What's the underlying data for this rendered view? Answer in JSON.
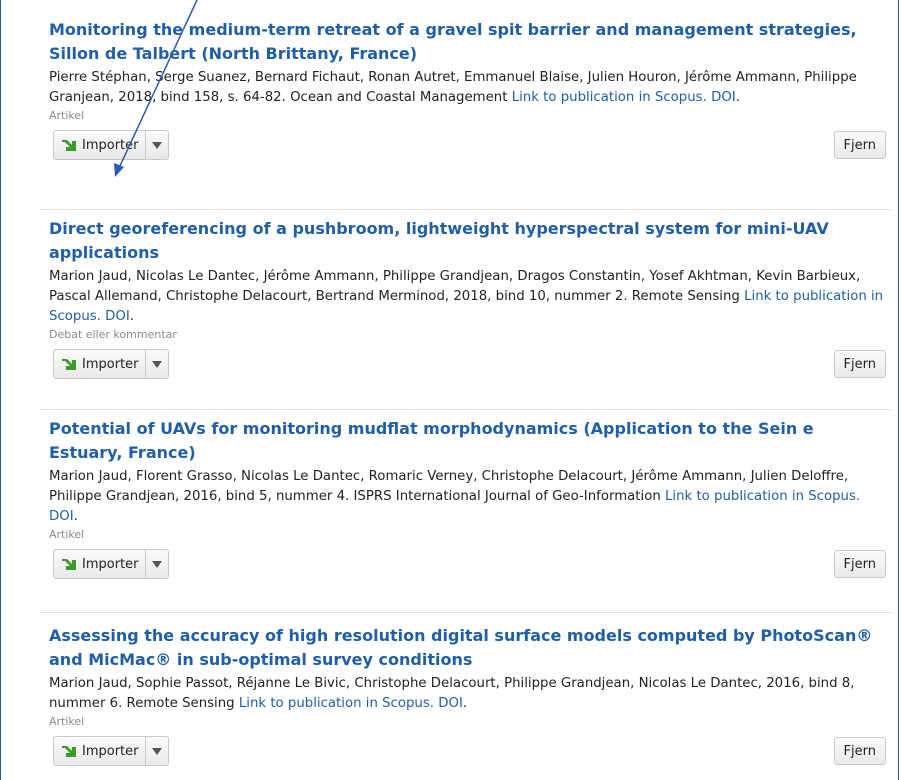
{
  "results": [
    {
      "title": "Monitoring the medium-term retreat of a gravel spit barrier and management strategies, Sillon de Talbert (North Brittany, France)",
      "meta_text": "Pierre Stéphan, Serge Suanez, Bernard Fichaut, Ronan Autret, Emmanuel Blaise, Julien Houron, Jérôme Ammann, Philippe Granjean, 2018, bind 158, s. 64-82. Ocean and Coastal Management ",
      "scopus_link": "Link to publication in Scopus.",
      "doi_link": "DOI",
      "type": "Artikel",
      "import_label": "Importer",
      "remove_label": "Fjern"
    },
    {
      "title": "Direct georeferencing of a pushbroom, lightweight hyperspectral system for mini-UAV applications",
      "meta_text": "Marion Jaud, Nicolas Le Dantec, Jérôme Ammann, Philippe Grandjean, Dragos Constantin, Yosef Akhtman, Kevin Barbieux, Pascal Allemand, Christophe Delacourt, Bertrand Merminod, 2018, bind 10, nummer 2. Remote Sensing ",
      "scopus_link": "Link to publication in Scopus.",
      "doi_link": "DOI",
      "type": "Debat eller kommentar",
      "import_label": "Importer",
      "remove_label": "Fjern"
    },
    {
      "title": "Potential of UAVs for monitoring mudflat morphodynamics (Application to the Sein e Estuary, France)",
      "meta_text": "Marion Jaud, Florent Grasso, Nicolas Le Dantec, Romaric Verney, Christophe Delacourt, Jérôme Ammann, Julien Deloffre, Philippe Grandjean, 2016, bind 5, nummer 4. ISPRS International Journal of Geo-Information ",
      "scopus_link": "Link to publication in Scopus.",
      "doi_link": "DOI",
      "type": "Artikel",
      "import_label": "Importer",
      "remove_label": "Fjern"
    },
    {
      "title": "Assessing the accuracy of high resolution digital surface models computed by PhotoScan® and MicMac® in sub-optimal survey conditions",
      "meta_text": "Marion Jaud, Sophie Passot, Réjanne Le Bivic, Christophe Delacourt, Philippe Grandjean, Nicolas Le Dantec, 2016, bind 8, nummer 6. Remote Sensing ",
      "scopus_link": "Link to publication in Scopus.",
      "doi_link": "DOI",
      "type": "Artikel",
      "import_label": "Importer",
      "remove_label": "Fjern"
    }
  ],
  "icons": {
    "import": "green-arrow-icon",
    "dropdown": "caret-down-icon"
  },
  "colors": {
    "link": "#1f5ea8",
    "frame": "#2a5db0",
    "import_arrow": "#3b9b2a"
  }
}
